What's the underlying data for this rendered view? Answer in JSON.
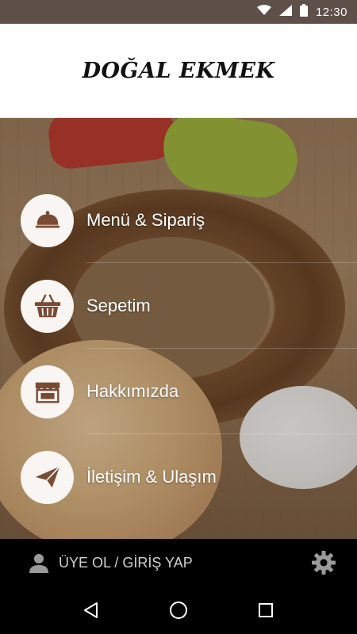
{
  "status_bar": {
    "time": "12:30",
    "icons": [
      "wifi-icon",
      "signal-icon",
      "battery-icon"
    ]
  },
  "header": {
    "title": "DOĞAL EKMEK"
  },
  "menu": {
    "items": [
      {
        "label": "Menü & Sipariş",
        "icon": "cloche-icon"
      },
      {
        "label": "Sepetim",
        "icon": "basket-icon"
      },
      {
        "label": "Hakkımızda",
        "icon": "storefront-icon"
      },
      {
        "label": "İletişim & Ulaşım",
        "icon": "paper-plane-icon"
      }
    ]
  },
  "bottom_bar": {
    "login_label": "ÜYE OL / GİRİŞ YAP",
    "user_icon": "user-icon",
    "settings_icon": "gear-icon"
  },
  "nav_bar": {
    "buttons": [
      "back-icon",
      "home-icon",
      "recents-icon"
    ]
  },
  "colors": {
    "status_bar": "#5e5049",
    "header_bg": "#ffffff",
    "icon_brown": "#7a4b33",
    "circle_bg": "#f8f5f2",
    "bottom_bg": "#000000"
  }
}
